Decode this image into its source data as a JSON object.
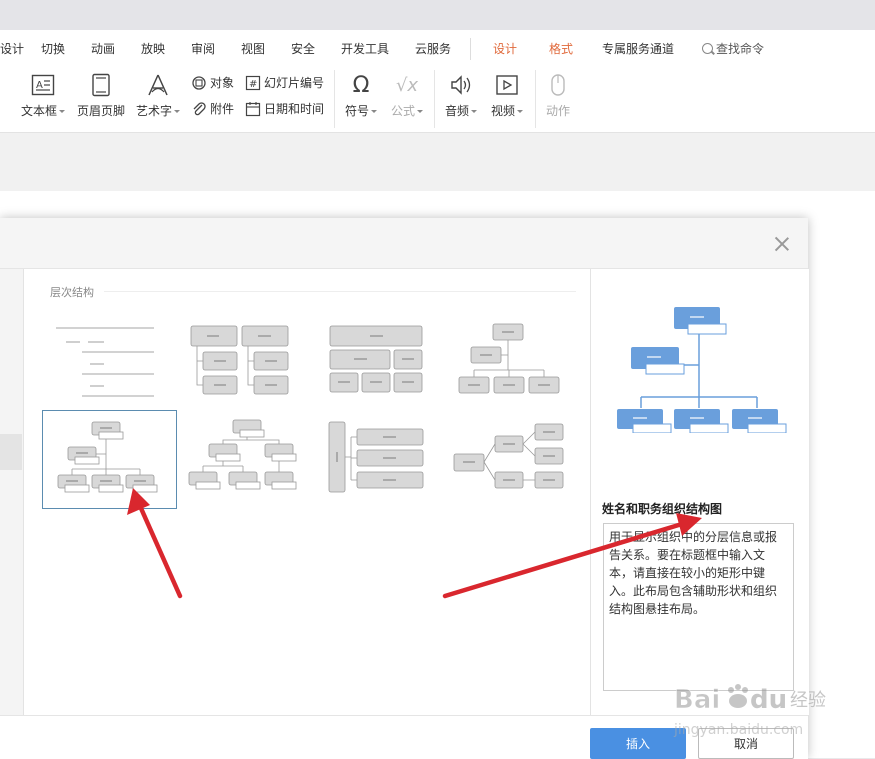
{
  "menu_tabs": [
    "设计",
    "切换",
    "动画",
    "放映",
    "审阅",
    "视图",
    "安全",
    "开发工具",
    "云服务",
    "设计",
    "格式",
    "专属服务通道"
  ],
  "search_label": "查找命令",
  "ribbon": {
    "textbox": "文本框",
    "header_footer": "页眉页脚",
    "wordart": "艺术字",
    "object": "对象",
    "slide_number": "幻灯片编号",
    "attachment": "附件",
    "date_time": "日期和时间",
    "symbol": "符号",
    "formula": "公式",
    "audio": "音频",
    "video": "视频",
    "action": "动作"
  },
  "dialog": {
    "category_title": "层次结构",
    "selected_layout_name": "姓名和职务组织结构图",
    "description": "用于显示组织中的分层信息或报告关系。要在标题框中输入文本，请直接在较小的矩形中键入。此布局包含辅助形状和组织结构图悬挂布局。",
    "insert_label": "插入",
    "cancel_label": "取消"
  },
  "watermark": "Baidu经验 jingyan.baidu.com",
  "colors": {
    "accent_tab": "#e0693b",
    "insert_button": "#4a90e2",
    "preview_shape": "#6a9fdc",
    "arrow": "#d9272e"
  }
}
